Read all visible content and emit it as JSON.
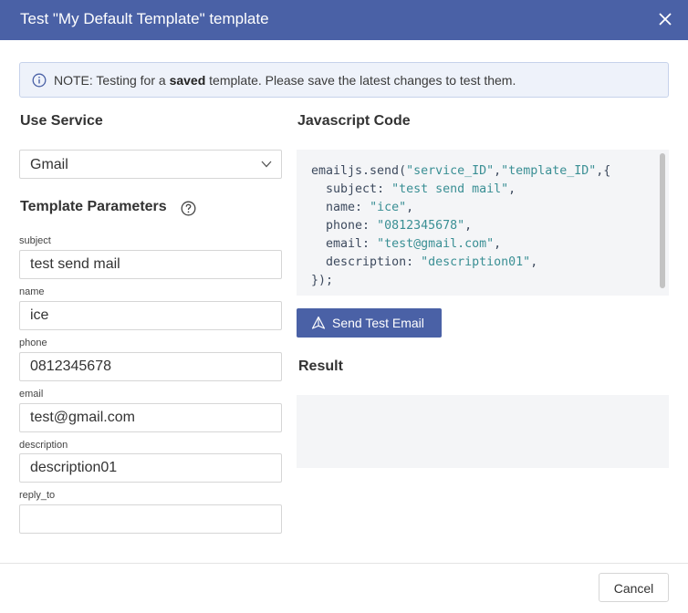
{
  "dialog": {
    "title": "Test \"My Default Template\" template",
    "close_icon": "close-icon"
  },
  "notice": {
    "icon": "info-icon",
    "prefix": "NOTE: Testing for a ",
    "bold": "saved",
    "suffix": " template. Please save the latest changes to test them."
  },
  "service": {
    "heading": "Use Service",
    "selected": "Gmail"
  },
  "params": {
    "heading": "Template Parameters",
    "fields": [
      {
        "label": "subject",
        "value": "test send mail"
      },
      {
        "label": "name",
        "value": "ice"
      },
      {
        "label": "phone",
        "value": "0812345678"
      },
      {
        "label": "email",
        "value": "test@gmail.com"
      },
      {
        "label": "description",
        "value": "description01"
      },
      {
        "label": "reply_to",
        "value": ""
      }
    ]
  },
  "code": {
    "heading": "Javascript Code",
    "call": "emailjs.send(",
    "service_id": "\"service_ID\"",
    "template_id": "\"template_ID\"",
    "open": ",{",
    "lines": [
      {
        "key": "subject",
        "value": "\"test send mail\""
      },
      {
        "key": "name",
        "value": "\"ice\""
      },
      {
        "key": "phone",
        "value": "\"0812345678\""
      },
      {
        "key": "email",
        "value": "\"test@gmail.com\""
      },
      {
        "key": "description",
        "value": "\"description01\""
      }
    ],
    "close": "});"
  },
  "send_button": {
    "label": "Send Test Email",
    "icon": "send-icon"
  },
  "result": {
    "heading": "Result",
    "text": ""
  },
  "footer": {
    "cancel_label": "Cancel"
  },
  "colors": {
    "primary": "#4a61a6",
    "code_string": "#3a8f94",
    "panel_bg": "#f4f5f7"
  }
}
